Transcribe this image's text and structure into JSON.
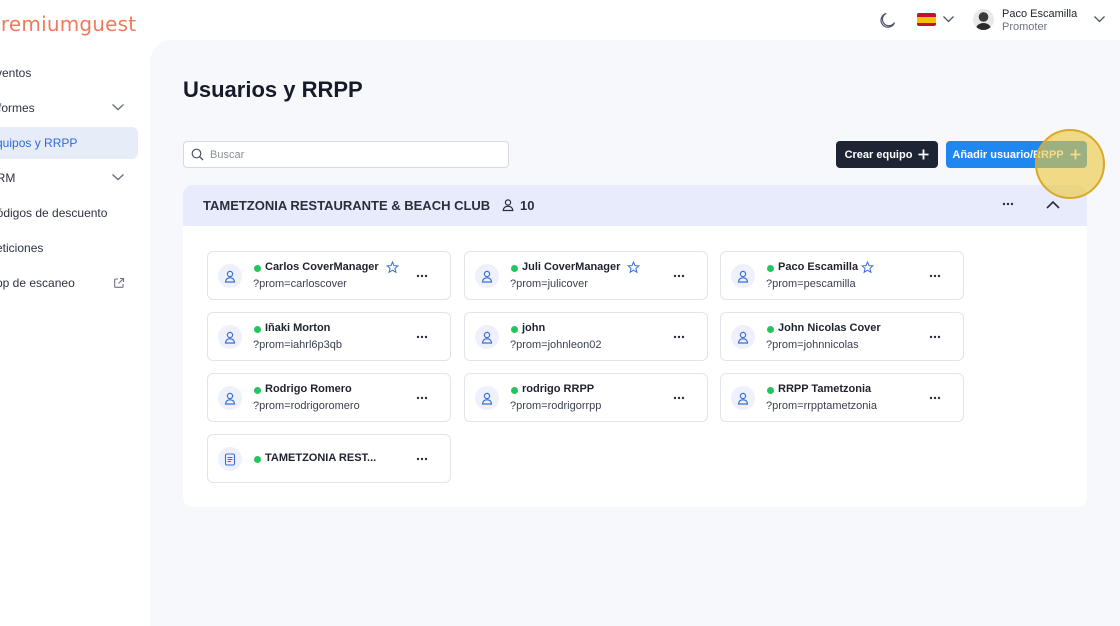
{
  "brand": {
    "logo_text": "premiumguest"
  },
  "header": {
    "user_name": "Paco Escamilla",
    "user_role": "Promoter"
  },
  "sidebar": {
    "items": [
      {
        "label": "Eventos"
      },
      {
        "label": "Informes"
      },
      {
        "label": "Equipos y RRPP"
      },
      {
        "label": "CRM"
      },
      {
        "label": "Códigos de descuento"
      },
      {
        "label": "Peticiones"
      },
      {
        "label": "App de escaneo"
      }
    ]
  },
  "main": {
    "title": "Usuarios y RRPP",
    "search_placeholder": "Buscar",
    "create_team_label": "Crear equipo",
    "add_user_label": "Añadir usuario/RRPP"
  },
  "team": {
    "name": "TAMETZONIA RESTAURANTE & BEACH CLUB",
    "member_count": "10",
    "members": [
      {
        "name": "Carlos CoverManager",
        "code": "?prom=carloscover",
        "starred": true
      },
      {
        "name": "Juli CoverManager",
        "code": "?prom=julicover",
        "starred": true
      },
      {
        "name": "Paco Escamilla",
        "code": "?prom=pescamilla",
        "starred": true
      },
      {
        "name": "Iñaki Morton",
        "code": "?prom=iahrl6p3qb",
        "starred": false
      },
      {
        "name": "john",
        "code": "?prom=johnleon02",
        "starred": false
      },
      {
        "name": "John Nicolas Cover",
        "code": "?prom=johnnicolas",
        "starred": false
      },
      {
        "name": "Rodrigo Romero",
        "code": "?prom=rodrigoromero",
        "starred": false
      },
      {
        "name": "rodrigo RRPP",
        "code": "?prom=rodrigorrpp",
        "starred": false
      },
      {
        "name": "RRPP Tametzonia",
        "code": "?prom=rrpptametzonia",
        "starred": false
      },
      {
        "name": "TAMETZONIA REST...",
        "code": "",
        "starred": false
      }
    ]
  },
  "colors": {
    "accent_blue": "#1e88f0",
    "dark_button": "#1d2433",
    "status_online": "#22c55e",
    "logo": "#f07a5c",
    "team_header_bg": "#e8ebfb"
  }
}
